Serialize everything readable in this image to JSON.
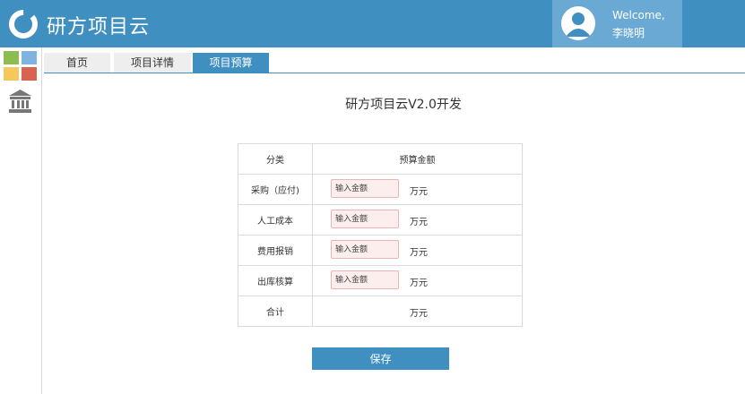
{
  "app": {
    "title": "研方项目云"
  },
  "user": {
    "welcome": "Welcome,",
    "name": "李晓明"
  },
  "tabs": [
    {
      "label": "首页"
    },
    {
      "label": "项目详情"
    },
    {
      "label": "项目预算",
      "active": true
    }
  ],
  "page": {
    "title": "研方项目云V2.0开发"
  },
  "table": {
    "header": {
      "category": "分类",
      "amount": "预算金额"
    },
    "rows": [
      {
        "category": "采购（应付)",
        "placeholder": "输入金额",
        "unit": "万元"
      },
      {
        "category": "人工成本",
        "placeholder": "输入金额",
        "unit": "万元"
      },
      {
        "category": "费用报销",
        "placeholder": "输入金额",
        "unit": "万元"
      },
      {
        "category": "出库核算",
        "placeholder": "输入金额",
        "unit": "万元"
      }
    ],
    "total": {
      "category": "合计",
      "unit": "万元"
    }
  },
  "actions": {
    "save_label": "保存"
  },
  "colors": {
    "brand": "#3f8fc0",
    "user_box": "#6aa9d3",
    "input_bg": "#fdeeee",
    "input_border": "#e8b4b4"
  },
  "tile_colors": [
    "#8fbc4f",
    "#7fb4e0",
    "#f4c85a",
    "#d9634f"
  ],
  "icons": [
    "logo-ring-icon",
    "avatar-icon",
    "apps-grid-icon",
    "bank-icon"
  ]
}
